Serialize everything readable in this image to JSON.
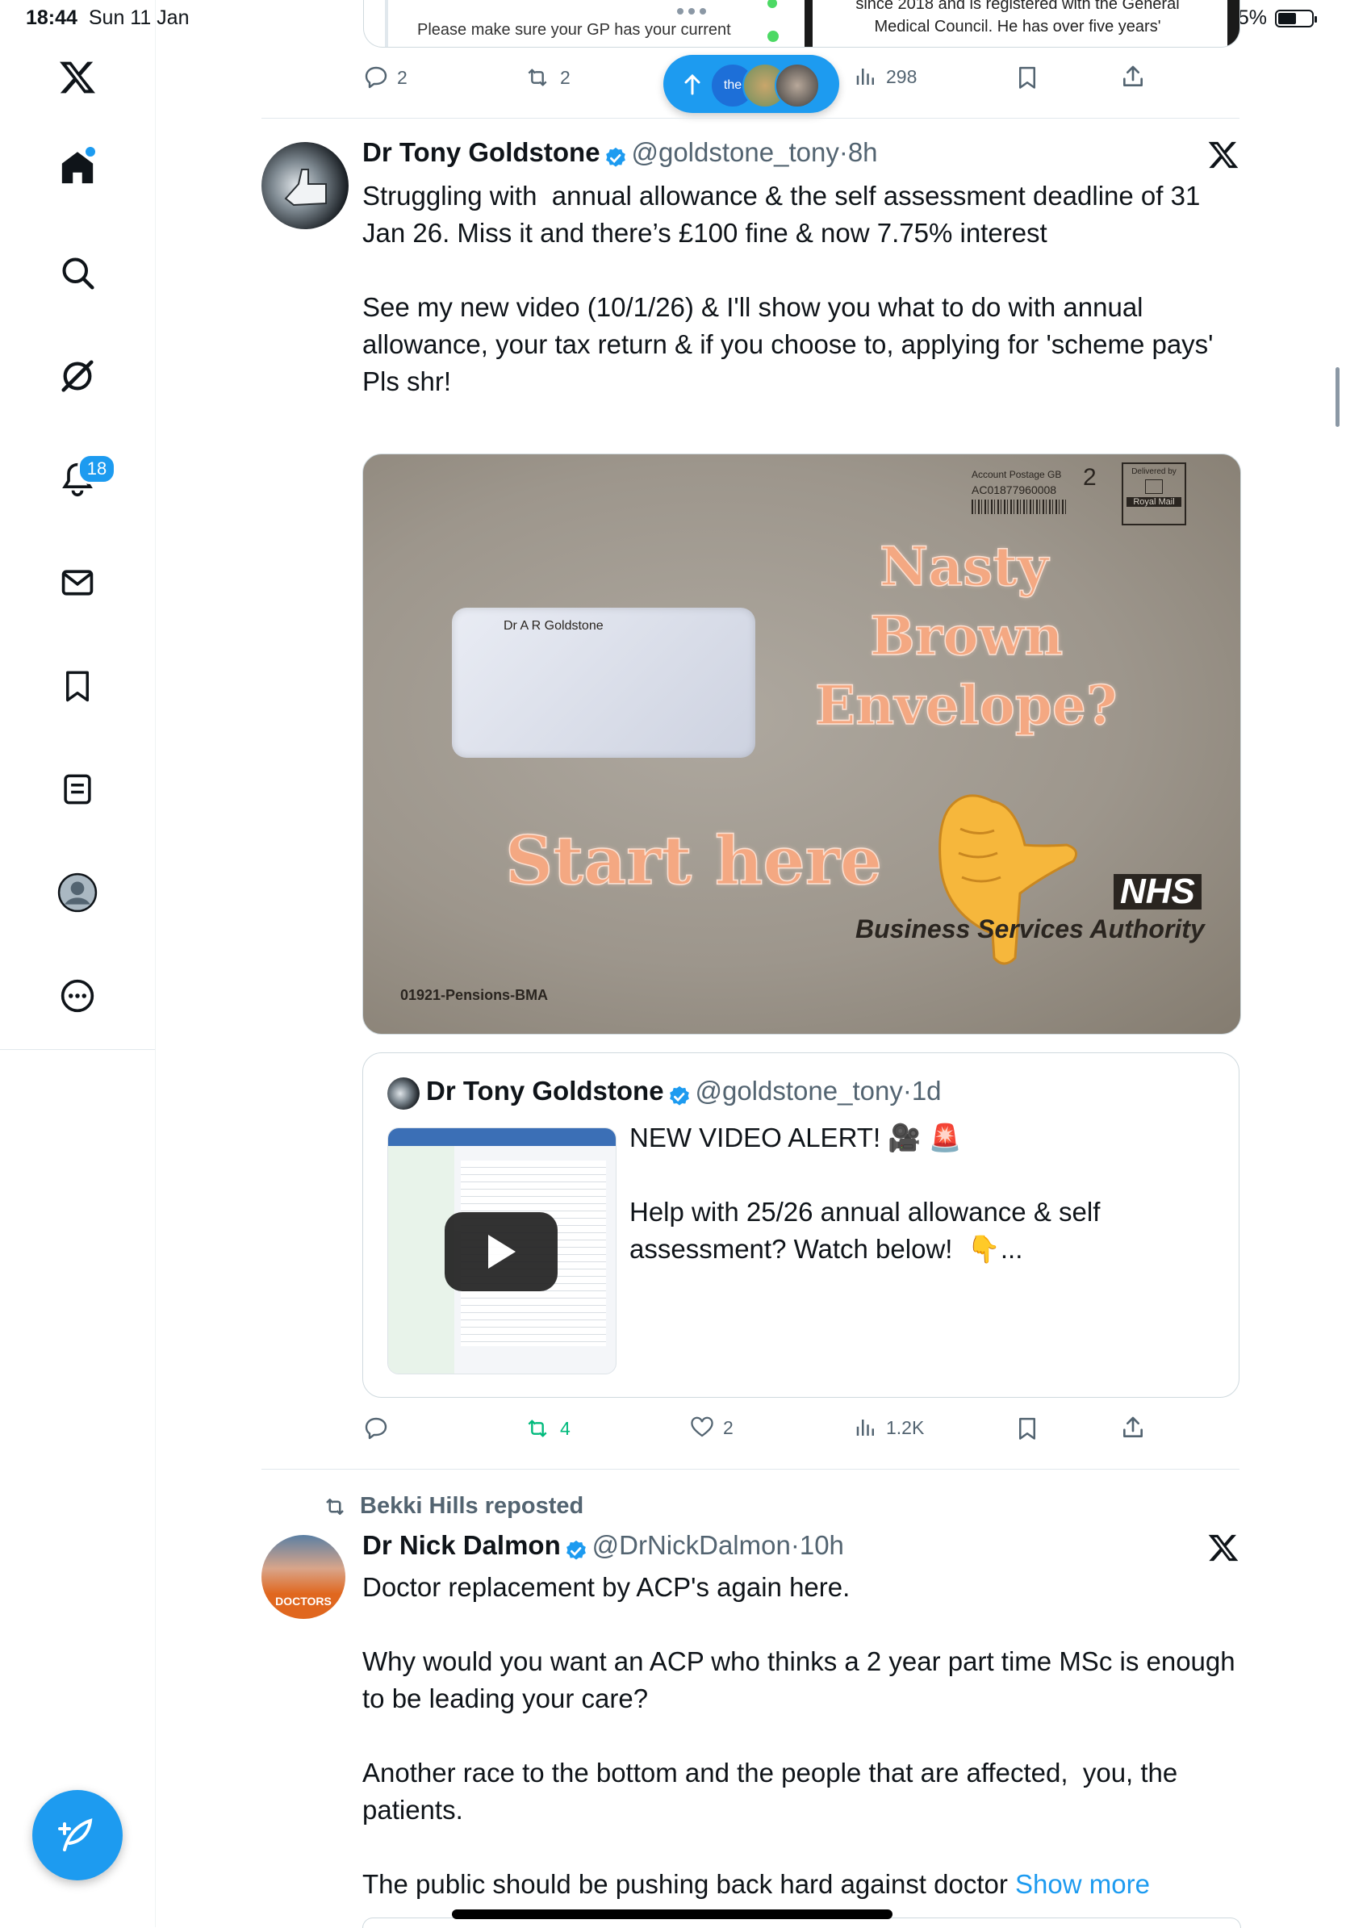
{
  "status_bar": {
    "time": "18:44",
    "date": "Sun 11 Jan",
    "battery": "55%"
  },
  "sidebar": {
    "notifications_count": "18",
    "items": [
      "x-logo",
      "home",
      "search",
      "grok",
      "notifications",
      "messages",
      "bookmarks",
      "lists",
      "profile",
      "more"
    ]
  },
  "top_card": {
    "left_text": "Please make sure your GP has your current",
    "right_text_1": "since 2018 and is registered with the General",
    "right_text_2": "Medical Council. He has over five years'"
  },
  "top_actions": {
    "replies": "2",
    "reposts": "2",
    "views": "298",
    "new_posts_label": "the"
  },
  "tweet1": {
    "name": "Dr Tony Goldstone",
    "handle": "@goldstone_tony",
    "time": "8h",
    "text": "Struggling with  annual allowance & the self assessment deadline of 31 Jan 26. Miss it and there’s £100 fine & now 7.75% interest\n\nSee my new video (10/1/26) & I'll show you what to do with annual allowance, your tax return & if you choose to, applying for 'scheme pays'\nPls shr!",
    "image": {
      "postage_line1": "Account Postage GB",
      "postage_line2": "AC01877960008",
      "postage_class": "2",
      "delivered_by": "Delivered by",
      "royal_mail": "Royal Mail",
      "address": "Dr A R Goldstone",
      "headline_1": "Nasty",
      "headline_2": "Brown",
      "headline_3": "Envelope?",
      "start_here": "Start here",
      "nhs": "NHS",
      "nhs_sub": "Business Services Authority",
      "ref": "01921-Pensions-BMA"
    },
    "quote": {
      "name": "Dr Tony Goldstone",
      "handle": "@goldstone_tony",
      "time": "1d",
      "line1": "NEW VIDEO ALERT! 🎥 🚨",
      "line2": "Help with 25/26 annual allowance & self assessment? Watch below!  👇..."
    },
    "actions": {
      "replies": "",
      "reposts": "4",
      "likes": "2",
      "views": "1.2K"
    }
  },
  "tweet2": {
    "reposted_by": "Bekki Hills reposted",
    "name": "Dr Nick Dalmon",
    "handle": "@DrNickDalmon",
    "time": "10h",
    "text": "Doctor replacement by ACP's again here.\n\nWhy would you want an ACP who thinks a 2 year part time MSc is enough to be leading your care?\n\nAnother race to the bottom and the people that are affected,  you, the patients.\n\nThe public should be pushing back hard against doctor ",
    "show_more": "Show more",
    "avatar_text": "DOCTORS"
  },
  "colors": {
    "accent": "#1d9bf0",
    "repost_green": "#00ba7c",
    "muted": "#536471"
  }
}
